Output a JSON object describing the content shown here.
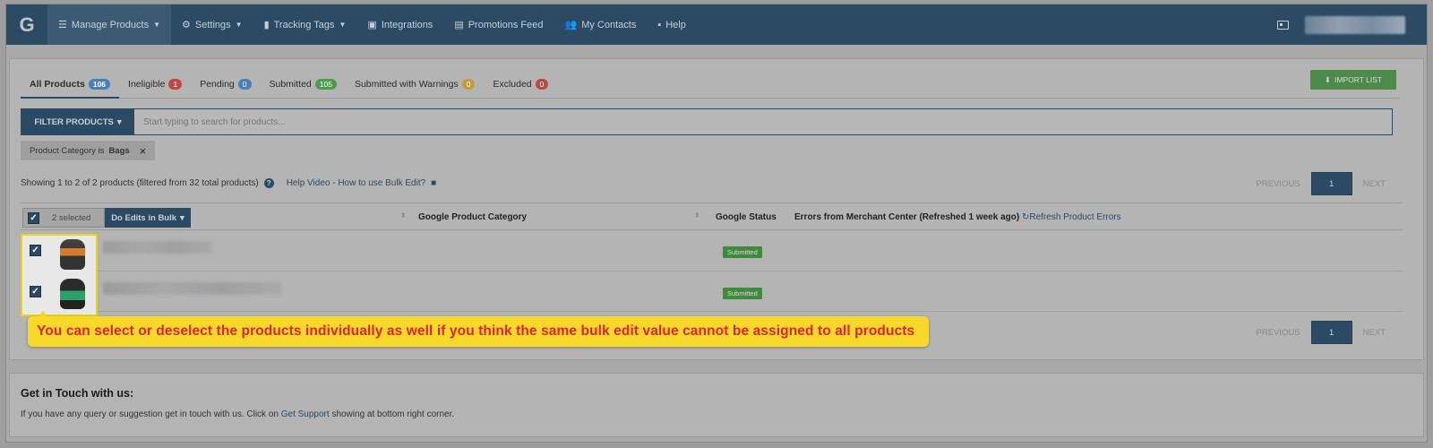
{
  "nav": {
    "logo": "G",
    "items": [
      {
        "label": "Manage Products",
        "icon": "list-icon",
        "caret": true
      },
      {
        "label": "Settings",
        "icon": "gear-icon",
        "caret": true
      },
      {
        "label": "Tracking Tags",
        "icon": "bar-chart-icon",
        "caret": true
      },
      {
        "label": "Integrations",
        "icon": "briefcase-icon",
        "caret": false
      },
      {
        "label": "Promotions Feed",
        "icon": "clipboard-icon",
        "caret": false
      },
      {
        "label": "My Contacts",
        "icon": "users-icon",
        "caret": false
      },
      {
        "label": "Help",
        "icon": "comment-icon",
        "caret": false
      }
    ]
  },
  "tabs": [
    {
      "label": "All Products",
      "count": "106",
      "color": "blue"
    },
    {
      "label": "Ineligible",
      "count": "1",
      "color": "red"
    },
    {
      "label": "Pending",
      "count": "0",
      "color": "blue"
    },
    {
      "label": "Submitted",
      "count": "105",
      "color": "green"
    },
    {
      "label": "Submitted with Warnings",
      "count": "0",
      "color": "yellow"
    },
    {
      "label": "Excluded",
      "count": "0",
      "color": "red"
    }
  ],
  "import_label": "IMPORT LIST",
  "filter": {
    "button_label": "FILTER PRODUCTS",
    "placeholder": "Start typing to search for products...",
    "chip_prefix": "Product Category is",
    "chip_value": "Bags",
    "chip_close": "×"
  },
  "showing_text": "Showing 1 to 2 of 2 products (filtered from 32 total products)",
  "help_video": "Help Video - How to use Bulk Edit?",
  "pager": {
    "prev": "PREVIOUS",
    "page": "1",
    "next": "NEXT"
  },
  "table": {
    "selected": "2 selected",
    "bulk_label": "Do Edits in Bulk",
    "col_category": "Google Product Category",
    "col_status": "Google Status",
    "col_errors": "Errors from Merchant Center (Refreshed 1 week ago)",
    "refresh_label": "Refresh Product Errors",
    "rows": [
      {
        "status": "Submitted"
      },
      {
        "status": "Submitted"
      }
    ]
  },
  "tooltip": "You can select or deselect the products individually as well if you think the same bulk edit value cannot be assigned to all products",
  "footer": {
    "title": "Get in Touch with us:",
    "text_before": "If you have any query or suggestion get in touch with us. Click on",
    "link": "Get Support",
    "text_after": "showing at bottom right corner."
  },
  "colors": {
    "navbar": "#2c4a63",
    "accent_green": "#4e8a4b",
    "tooltip_bg": "#f7d82b",
    "tooltip_text": "#e0242a"
  }
}
